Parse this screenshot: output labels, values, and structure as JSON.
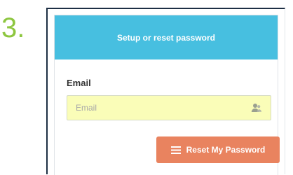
{
  "step": {
    "number": "3."
  },
  "panel": {
    "title": "Setup or reset password",
    "email": {
      "label": "Email",
      "placeholder": "Email",
      "value": "",
      "icon": "user-icon"
    },
    "reset_button": {
      "label": "Reset My Password",
      "icon": "menu-icon"
    }
  },
  "colors": {
    "step_number": "#8dc63f",
    "header_bg": "#47bfe0",
    "field_bg": "#fafdb8",
    "button_bg": "#e9835f"
  }
}
